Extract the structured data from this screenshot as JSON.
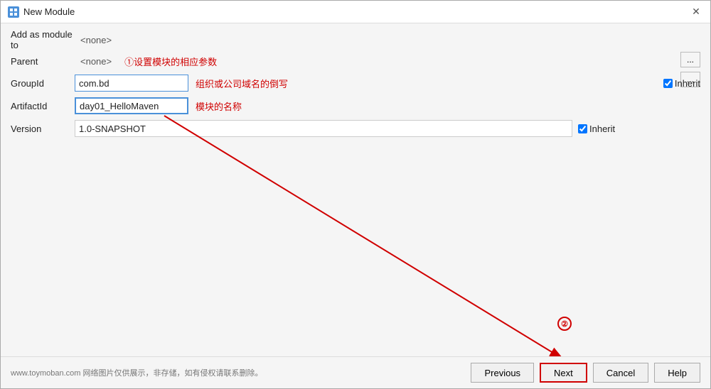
{
  "dialog": {
    "title": "New Module",
    "title_icon_label": "module-icon"
  },
  "header": {
    "add_as_module_label": "Add as module to",
    "add_as_module_value": "<none>",
    "parent_label": "Parent",
    "parent_value": "<none>",
    "annotation1": "①设置模块的相应参数",
    "btn_ellipsis": "...",
    "btn_ellipsis2": "..."
  },
  "fields": {
    "groupid_label": "GroupId",
    "groupid_value": "com.bd",
    "groupid_annotation": "组织或公司域名的倒写",
    "artifactid_label": "ArtifactId",
    "artifactid_value": "day01_HelloMaven",
    "artifactid_annotation": "模块的名称",
    "version_label": "Version",
    "version_value": "1.0-SNAPSHOT",
    "inherit_label": "Inherit",
    "inherit_label2": "Inherit"
  },
  "footer": {
    "watermark": "www.toymoban.com 网络图片仅供展示，非存储，如有侵权请联系删除。",
    "btn_previous": "Previous",
    "btn_next": "Next",
    "btn_cancel": "Cancel",
    "btn_help": "Help"
  },
  "annotation": {
    "circle2_label": "②"
  }
}
